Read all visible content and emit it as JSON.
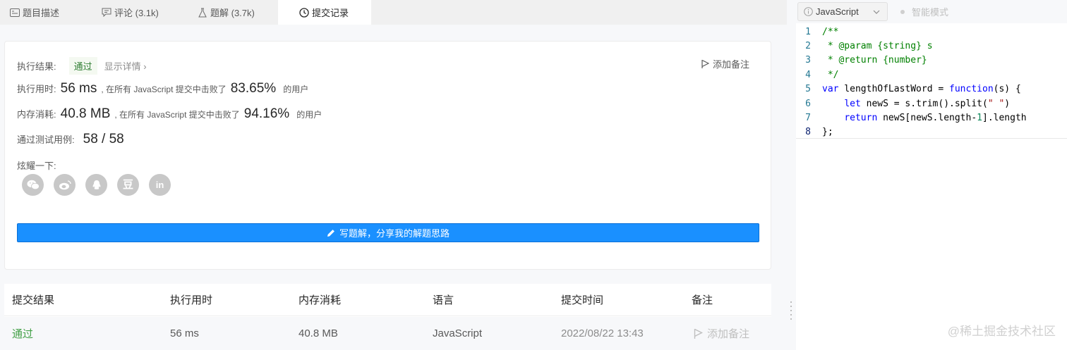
{
  "tabs": [
    {
      "label": "题目描述",
      "icon": "description-icon"
    },
    {
      "label": "评论 (3.1k)",
      "icon": "comment-icon"
    },
    {
      "label": "题解 (3.7k)",
      "icon": "flask-icon"
    },
    {
      "label": "提交记录",
      "icon": "clock-icon"
    }
  ],
  "result": {
    "label": "执行结果:",
    "status": "通过",
    "detail_link": "显示详情 ›",
    "add_note": "添加备注",
    "runtime_label": "执行用时:",
    "runtime_value": "56 ms",
    "runtime_text": ", 在所有 JavaScript 提交中击败了",
    "runtime_percent": "83.65%",
    "users_suffix": "的用户",
    "memory_label": "内存消耗:",
    "memory_value": "40.8 MB",
    "memory_text": ", 在所有 JavaScript 提交中击败了",
    "memory_percent": "94.16%",
    "tests_label": "通过测试用例:",
    "tests_value": "58 / 58",
    "share_label": "炫耀一下:",
    "share_icons": [
      "wechat-icon",
      "weibo-icon",
      "qq-icon",
      "douban-icon",
      "linkedin-icon"
    ],
    "write_button": "写题解，分享我的解题思路"
  },
  "table": {
    "headers": [
      "提交结果",
      "执行用时",
      "内存消耗",
      "语言",
      "提交时间",
      "备注"
    ],
    "rows": [
      {
        "result": "通过",
        "runtime": "56 ms",
        "memory": "40.8 MB",
        "language": "JavaScript",
        "time": "2022/08/22 13:43",
        "note": "添加备注"
      }
    ]
  },
  "editor": {
    "language": "JavaScript",
    "smart_mode": "智能模式"
  },
  "watermark": "@稀土掘金技术社区",
  "colors": {
    "accent": "#1a90ff",
    "success": "#2e7d32",
    "tab_active_bg": "#ffffff"
  }
}
